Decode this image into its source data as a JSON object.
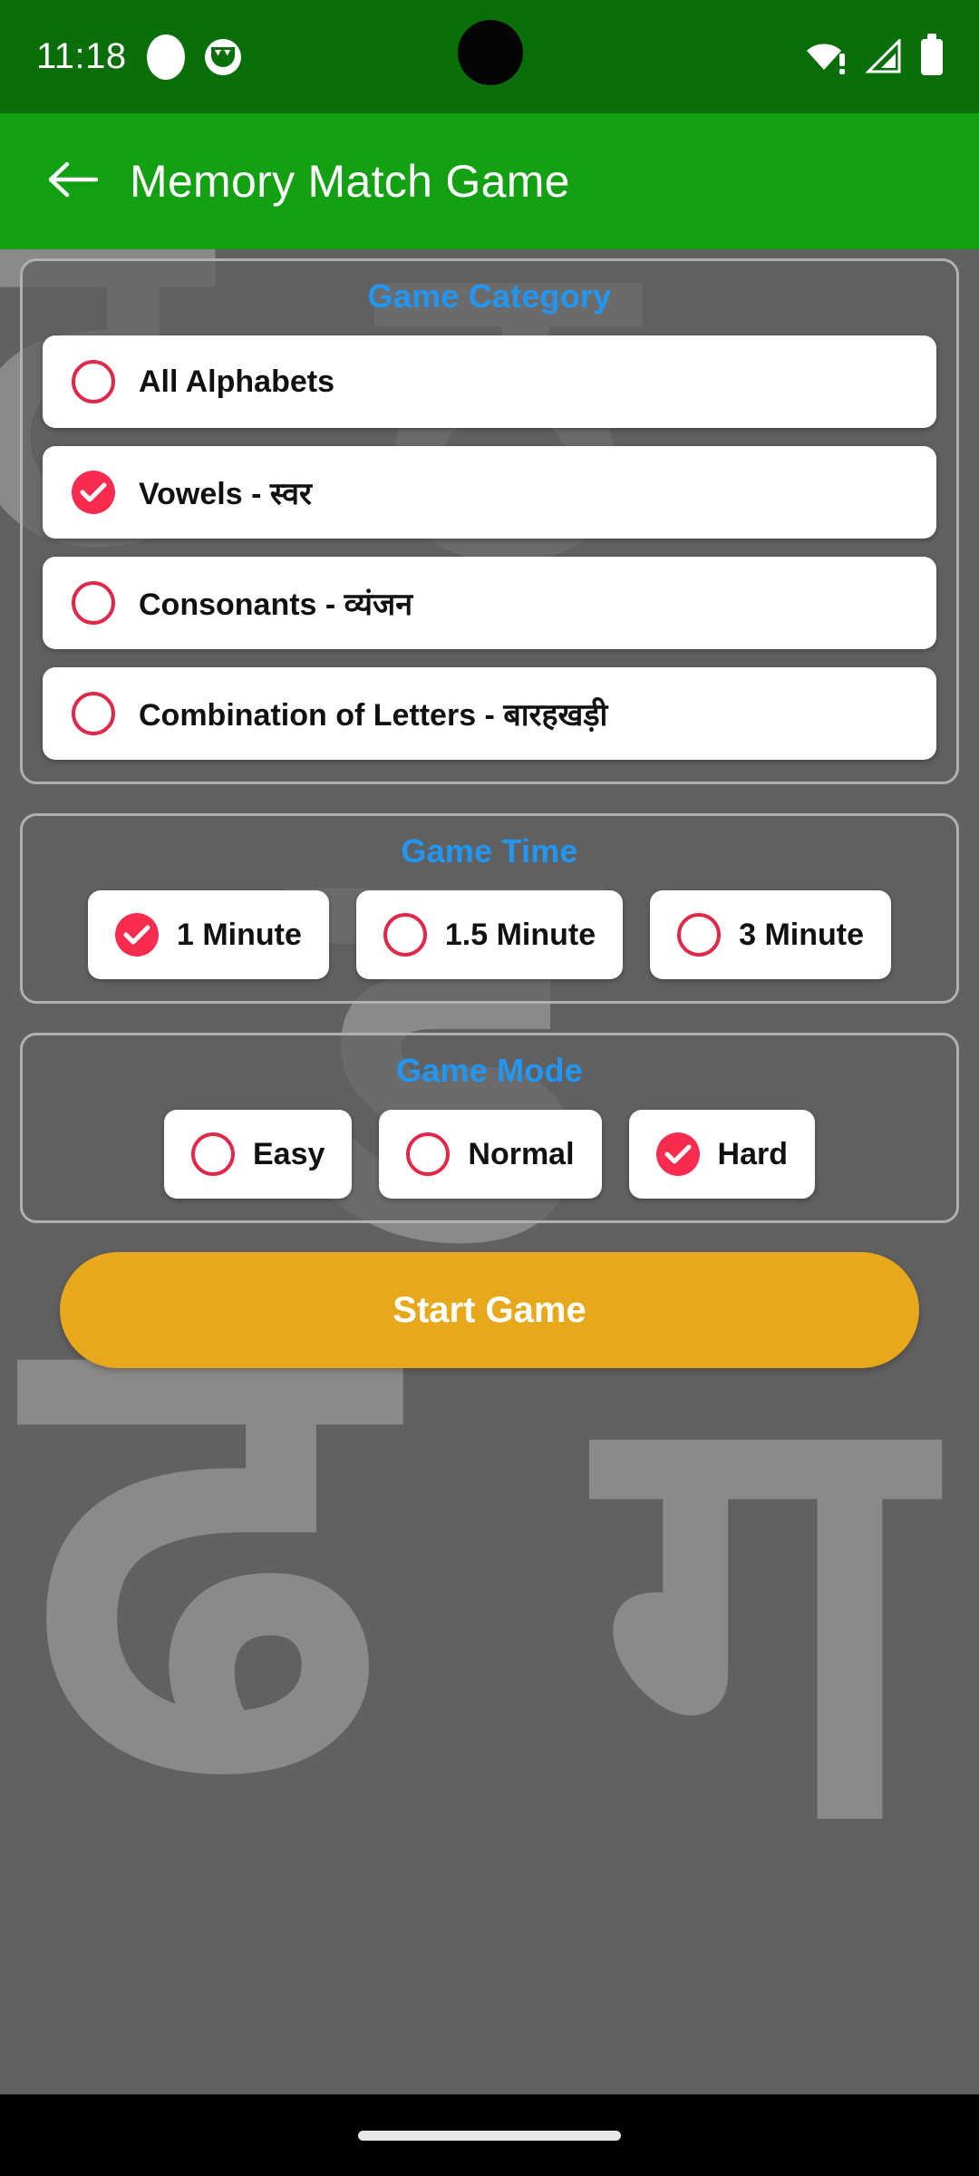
{
  "status_bar": {
    "time": "11:18",
    "left_icons": [
      "circle-indicator-icon",
      "cat-notification-icon"
    ],
    "right_icons": [
      "wifi-warning-icon",
      "cellular-signal-off-icon",
      "battery-full-icon"
    ],
    "background_color": "#0a6e0a"
  },
  "app_bar": {
    "back_icon": "back-arrow-icon",
    "title": "Memory Match Game",
    "background_color": "#13a013",
    "text_color": "#ffffff"
  },
  "theme": {
    "accent_blue": "#2196f3",
    "radio_selected": "#f72c4f",
    "radio_unselected_ring": "#e0294a",
    "card_border": "#b0b0b0",
    "page_background": "#616161",
    "start_button": "#e8a81b"
  },
  "sections": [
    {
      "title": "Game Category",
      "layout": "list",
      "options": [
        {
          "label": "All Alphabets",
          "selected": false
        },
        {
          "label": "Vowels - स्वर",
          "selected": true
        },
        {
          "label": "Consonants - व्यंजन",
          "selected": false
        },
        {
          "label": "Combination of Letters - बारहखड़ी",
          "selected": false
        }
      ]
    },
    {
      "title": "Game Time",
      "layout": "chips",
      "options": [
        {
          "label": "1 Minute",
          "selected": true
        },
        {
          "label": "1.5 Minute",
          "selected": false
        },
        {
          "label": "3 Minute",
          "selected": false
        }
      ]
    },
    {
      "title": "Game Mode",
      "layout": "chips",
      "options": [
        {
          "label": "Easy",
          "selected": false
        },
        {
          "label": "Normal",
          "selected": false
        },
        {
          "label": "Hard",
          "selected": true
        }
      ]
    }
  ],
  "start_button": {
    "label": "Start Game"
  },
  "watermark": {
    "glyphs": [
      "ट",
      "ठ",
      "ड",
      "ढ",
      "ग"
    ]
  },
  "nav_bar": {
    "gesture_pill": "home-gesture-pill"
  }
}
